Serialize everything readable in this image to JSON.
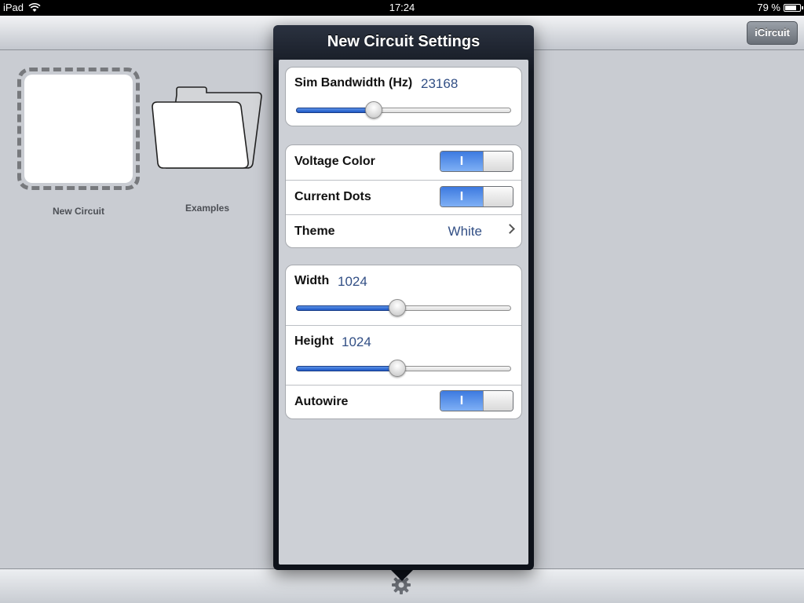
{
  "status_bar": {
    "device": "iPad",
    "time": "17:24",
    "battery": "79 %",
    "battery_level": 0.79
  },
  "navbar": {
    "button_label": "iCircuit"
  },
  "home": {
    "tiles": [
      {
        "label": "New Circuit"
      },
      {
        "label": "Examples"
      }
    ]
  },
  "popover": {
    "title": "New Circuit Settings",
    "sim_bandwidth": {
      "label": "Sim Bandwidth (Hz)",
      "value": "23168",
      "slider_level": 0.36
    },
    "voltage_color": {
      "label": "Voltage Color",
      "on": true,
      "on_glyph": "I"
    },
    "current_dots": {
      "label": "Current Dots",
      "on": true,
      "on_glyph": "I"
    },
    "theme": {
      "label": "Theme",
      "value": "White"
    },
    "width": {
      "label": "Width",
      "value": "1024",
      "slider_level": 0.47
    },
    "height": {
      "label": "Height",
      "value": "1024",
      "slider_level": 0.47
    },
    "autowire": {
      "label": "Autowire",
      "on": true,
      "on_glyph": "I"
    }
  },
  "colors": {
    "accent_blue": "#3d7ae0",
    "value_text": "#324f85",
    "popover_frame": "#141922"
  },
  "icons": {
    "wifi": "wifi-icon",
    "battery": "battery-icon",
    "folder": "folder-icon",
    "gear": "gear-icon",
    "chevron": "chevron-right-icon"
  }
}
